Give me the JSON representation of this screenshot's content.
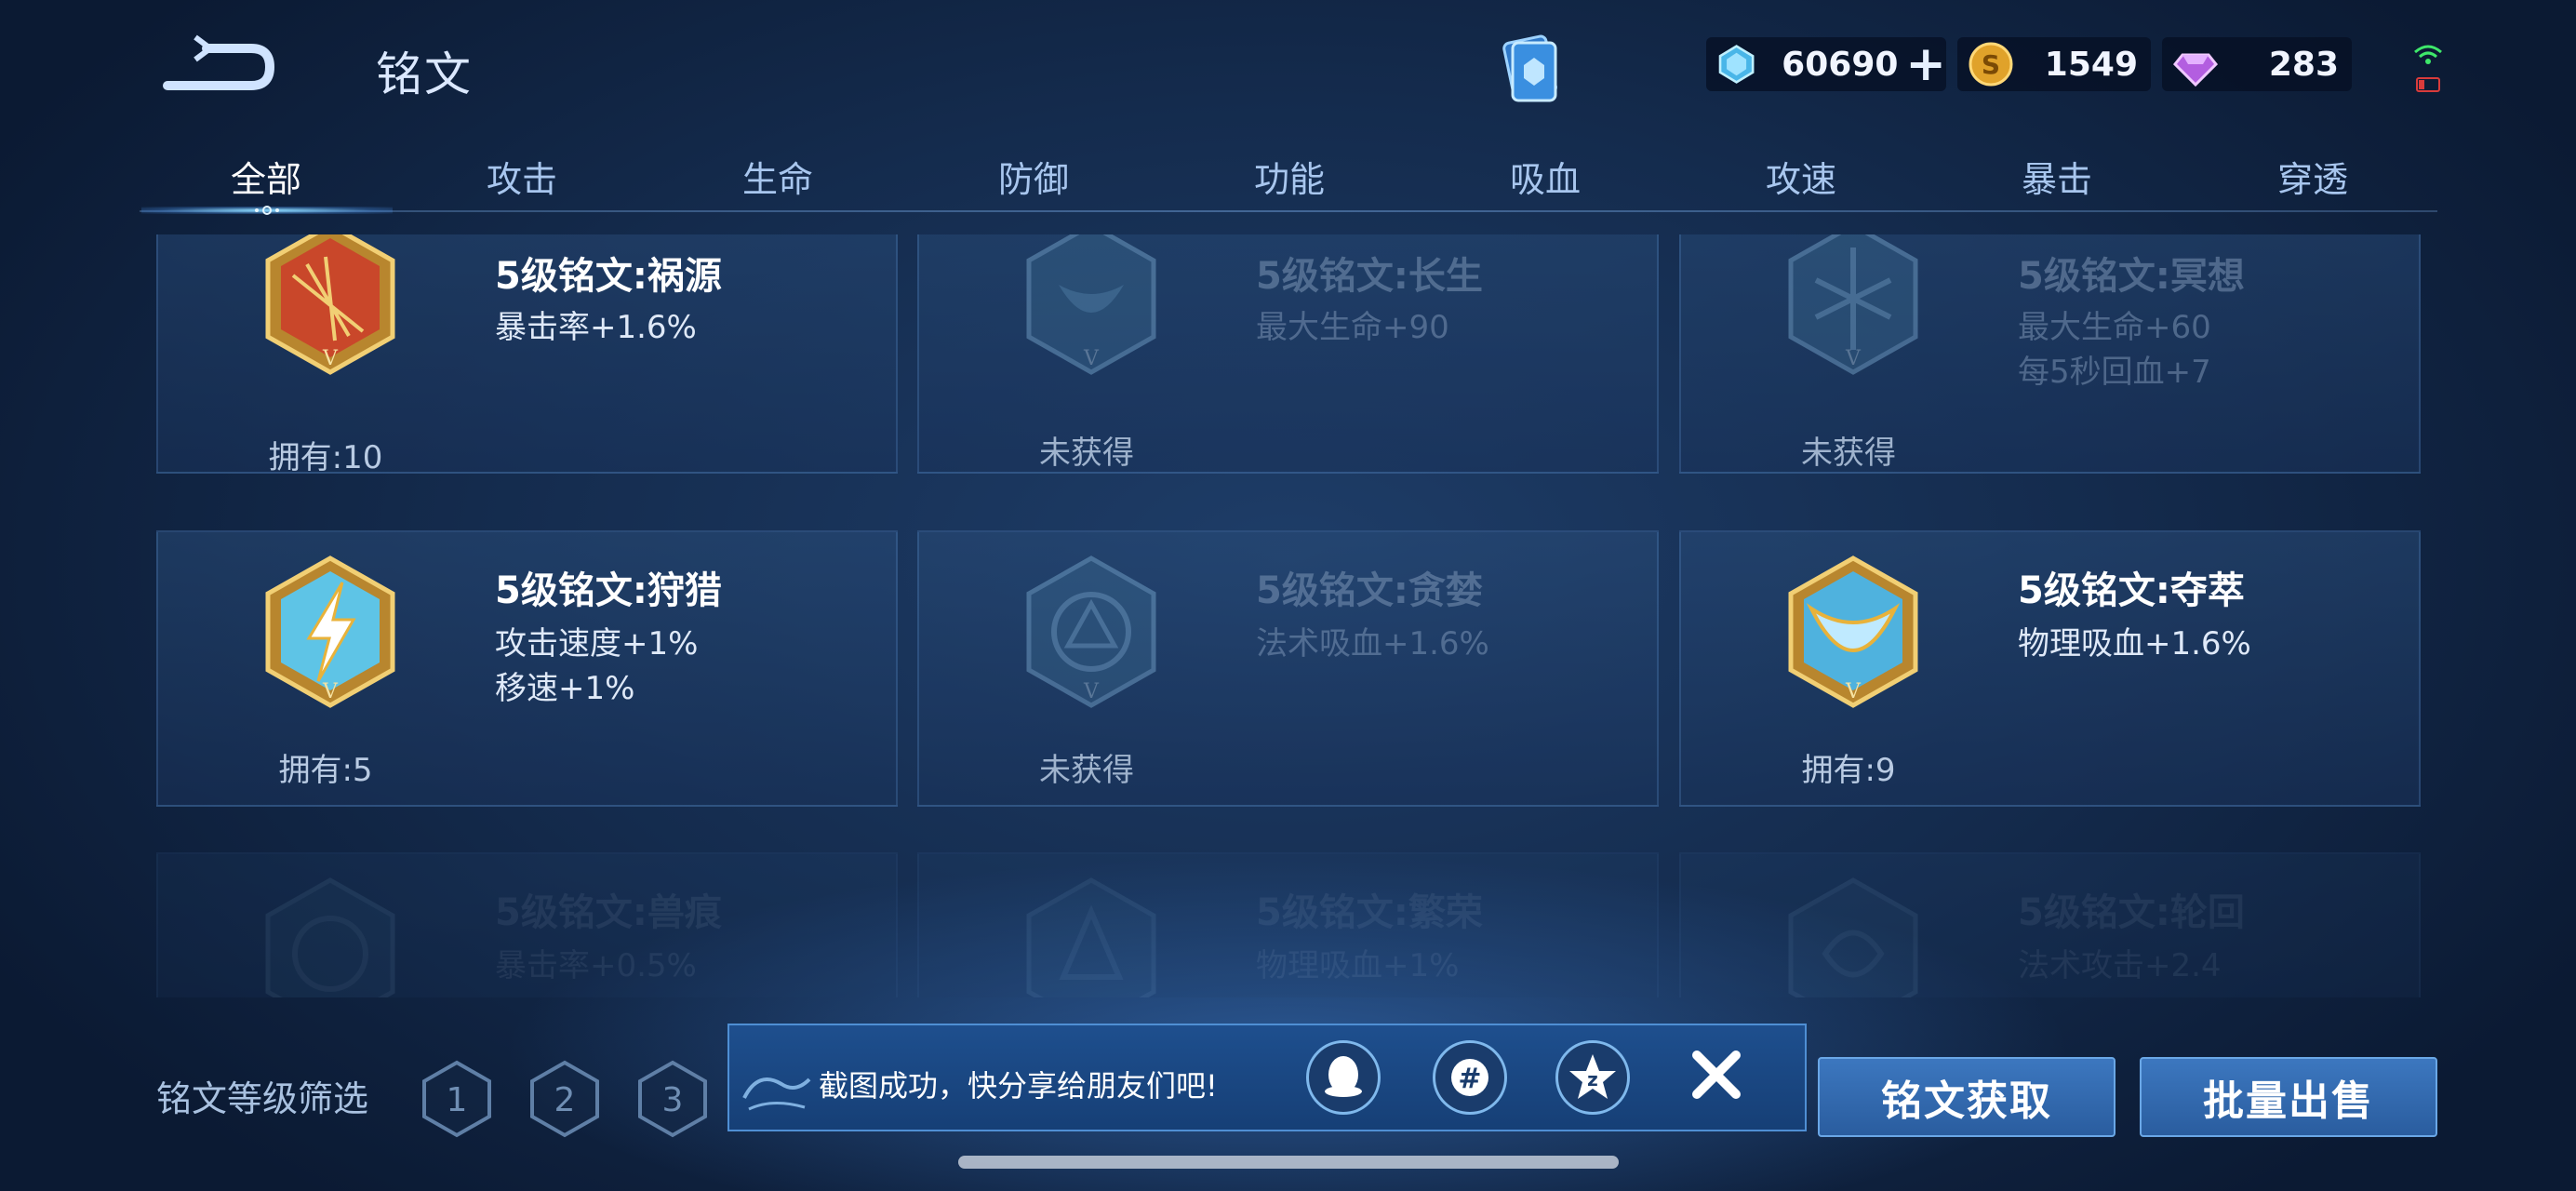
{
  "header": {
    "title": "铭文",
    "currencies": {
      "gem": {
        "value": "60690",
        "plus": "+"
      },
      "coin": {
        "value": "1549"
      },
      "diamond": {
        "value": "283"
      }
    }
  },
  "tabs": [
    "全部",
    "攻击",
    "生命",
    "防御",
    "功能",
    "吸血",
    "攻速",
    "暴击",
    "穿透"
  ],
  "active_tab": "全部",
  "cards": [
    {
      "name": "5级铭文:祸源",
      "stats": [
        "暴击率+1.6%"
      ],
      "owned": "拥有:10",
      "locked": false,
      "color": "#c0392b",
      "icon": "red-rune-icon"
    },
    {
      "name": "5级铭文:长生",
      "stats": [
        "最大生命+90"
      ],
      "owned": "未获得",
      "locked": true,
      "color": "#2c5f8a",
      "icon": "locked-rune-icon"
    },
    {
      "name": "5级铭文:冥想",
      "stats": [
        "最大生命+60",
        "每5秒回血+7"
      ],
      "owned": "未获得",
      "locked": true,
      "color": "#2c5f8a",
      "icon": "locked-rune-icon"
    },
    {
      "name": "5级铭文:狩猎",
      "stats": [
        "攻击速度+1%",
        "移速+1%"
      ],
      "owned": "拥有:5",
      "locked": false,
      "color": "#5fc8e8",
      "icon": "lightning-rune-icon"
    },
    {
      "name": "5级铭文:贪婪",
      "stats": [
        "法术吸血+1.6%"
      ],
      "owned": "未获得",
      "locked": true,
      "color": "#2c5f8a",
      "icon": "locked-rune-icon"
    },
    {
      "name": "5级铭文:夺萃",
      "stats": [
        "物理吸血+1.6%"
      ],
      "owned": "拥有:9",
      "locked": false,
      "color": "#5fc8e8",
      "icon": "blue-rune-icon"
    },
    {
      "name": "5级铭文:兽痕",
      "stats": [
        "暴击率+0.5%"
      ],
      "owned": "",
      "locked": true,
      "color": "#2c5f8a",
      "icon": "locked-rune-icon"
    },
    {
      "name": "5级铭文:繁荣",
      "stats": [
        "物理吸血+1%"
      ],
      "owned": "",
      "locked": true,
      "color": "#2c5f8a",
      "icon": "locked-rune-icon"
    },
    {
      "name": "5级铭文:轮回",
      "stats": [
        "法术攻击+2.4"
      ],
      "owned": "",
      "locked": true,
      "color": "#2c5f8a",
      "icon": "locked-rune-icon"
    }
  ],
  "filter": {
    "label": "铭文等级筛选",
    "levels": [
      "1",
      "2",
      "3"
    ]
  },
  "toast": {
    "text": "截图成功，快分享给朋友们吧!",
    "share_icons": [
      "qq-icon",
      "wechat-moments-icon",
      "qzone-icon"
    ]
  },
  "buttons": {
    "acquire": "铭文获取",
    "bulk_sell": "批量出售"
  }
}
